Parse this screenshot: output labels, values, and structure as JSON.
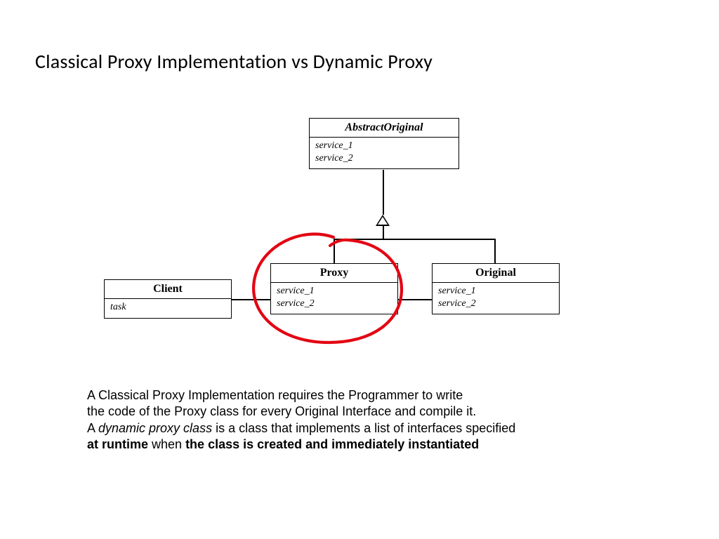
{
  "title": "Classical Proxy Implementation vs Dynamic Proxy",
  "boxes": {
    "abstract": {
      "name": "AbstractOriginal",
      "methods": [
        "service_1",
        "service_2"
      ]
    },
    "proxy": {
      "name": "Proxy",
      "methods": [
        "service_1",
        "service_2"
      ]
    },
    "original": {
      "name": "Original",
      "methods": [
        "service_1",
        "service_2"
      ]
    },
    "client": {
      "name": "Client",
      "methods": [
        "task"
      ]
    }
  },
  "desc": {
    "p1_a": "A Classical Proxy Implementation requires the Programmer to write",
    "p1_b": "the code of the Proxy class  for every  Original Interface and compile it.",
    "p2_a": "A ",
    "p2_italic": "dynamic proxy class",
    "p2_b": "  is a  class that implements a list of interfaces specified",
    "p3_bold_a": "at runtime",
    "p3_mid": " when ",
    "p3_bold_b": "the class is created and immediately instantiated"
  },
  "colors": {
    "highlight_stroke": "#e30613"
  }
}
